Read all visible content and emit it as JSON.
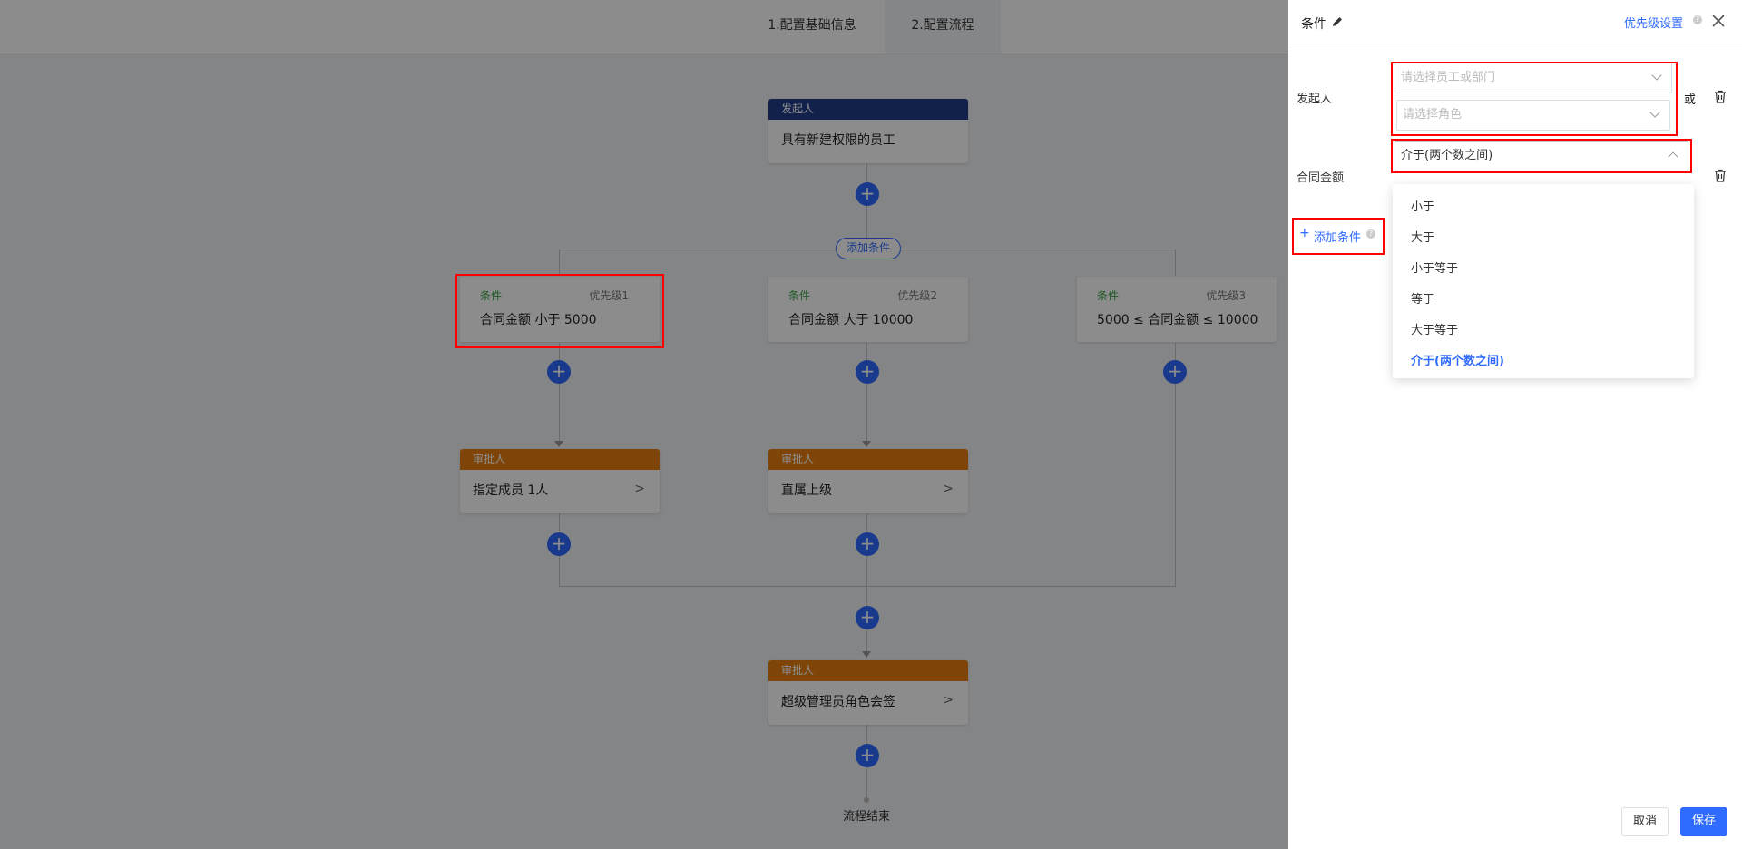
{
  "steps": {
    "step1": "1.配置基础信息",
    "step2": "2.配置流程"
  },
  "colors": {
    "accent": "#2f6bff",
    "initiator_header": "#1f3d8a",
    "approver_header": "#e87f10",
    "condition_label": "#3aa646",
    "highlight": "#ff0000"
  },
  "flow": {
    "initiator": {
      "header": "发起人",
      "body": "具有新建权限的员工"
    },
    "add_condition_label": "添加条件",
    "conditions": [
      {
        "label": "条件",
        "priority": "优先级1",
        "text": "合同金额 小于 5000"
      },
      {
        "label": "条件",
        "priority": "优先级2",
        "text": "合同金额 大于 10000"
      },
      {
        "label": "条件",
        "priority": "优先级3",
        "text": "5000 ≤ 合同金额 ≤ 10000"
      }
    ],
    "approvers": [
      {
        "header": "审批人",
        "body": "指定成员 1人"
      },
      {
        "header": "审批人",
        "body": "直属上级"
      }
    ],
    "final_approver": {
      "header": "审批人",
      "body": "超级管理员角色会签"
    },
    "end_label": "流程结束",
    "plus_icon": "plus-icon"
  },
  "panel": {
    "title": "条件",
    "priority_link": "优先级设置",
    "initiator_label": "发起人",
    "employee_placeholder": "请选择员工或部门",
    "role_placeholder": "请选择角色",
    "or_label": "或",
    "amount_label": "合同金额",
    "operator_value": "介于(两个数之间)",
    "add_condition": "添加条件",
    "operator_options": [
      "小于",
      "大于",
      "小于等于",
      "等于",
      "大于等于",
      "介于(两个数之间)"
    ],
    "selected_option": "介于(两个数之间)",
    "cancel": "取消",
    "save": "保存"
  }
}
